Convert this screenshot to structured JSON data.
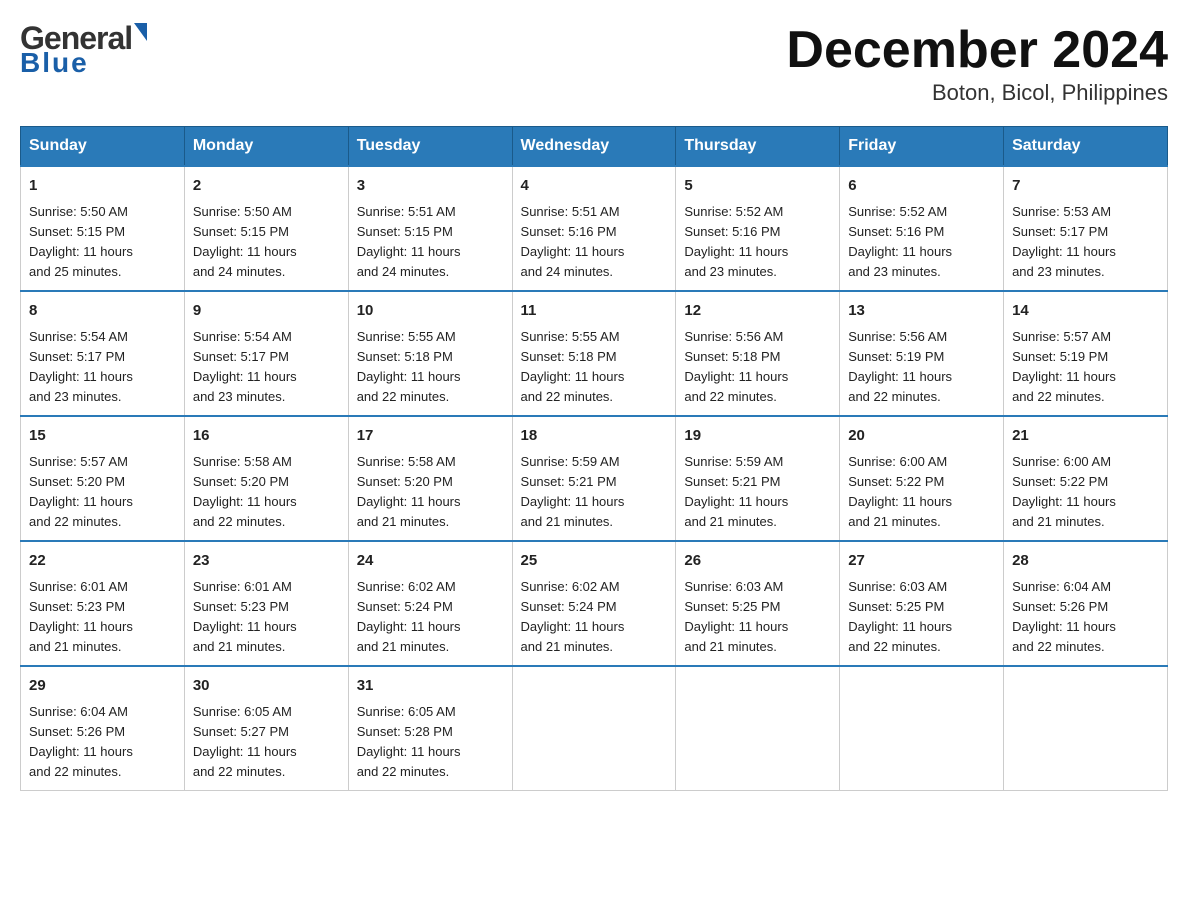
{
  "header": {
    "title": "December 2024",
    "subtitle": "Boton, Bicol, Philippines",
    "logo_general": "General",
    "logo_blue": "Blue"
  },
  "days_of_week": [
    "Sunday",
    "Monday",
    "Tuesday",
    "Wednesday",
    "Thursday",
    "Friday",
    "Saturday"
  ],
  "weeks": [
    [
      {
        "day": "1",
        "sunrise": "5:50 AM",
        "sunset": "5:15 PM",
        "daylight": "11 hours and 25 minutes."
      },
      {
        "day": "2",
        "sunrise": "5:50 AM",
        "sunset": "5:15 PM",
        "daylight": "11 hours and 24 minutes."
      },
      {
        "day": "3",
        "sunrise": "5:51 AM",
        "sunset": "5:15 PM",
        "daylight": "11 hours and 24 minutes."
      },
      {
        "day": "4",
        "sunrise": "5:51 AM",
        "sunset": "5:16 PM",
        "daylight": "11 hours and 24 minutes."
      },
      {
        "day": "5",
        "sunrise": "5:52 AM",
        "sunset": "5:16 PM",
        "daylight": "11 hours and 23 minutes."
      },
      {
        "day": "6",
        "sunrise": "5:52 AM",
        "sunset": "5:16 PM",
        "daylight": "11 hours and 23 minutes."
      },
      {
        "day": "7",
        "sunrise": "5:53 AM",
        "sunset": "5:17 PM",
        "daylight": "11 hours and 23 minutes."
      }
    ],
    [
      {
        "day": "8",
        "sunrise": "5:54 AM",
        "sunset": "5:17 PM",
        "daylight": "11 hours and 23 minutes."
      },
      {
        "day": "9",
        "sunrise": "5:54 AM",
        "sunset": "5:17 PM",
        "daylight": "11 hours and 23 minutes."
      },
      {
        "day": "10",
        "sunrise": "5:55 AM",
        "sunset": "5:18 PM",
        "daylight": "11 hours and 22 minutes."
      },
      {
        "day": "11",
        "sunrise": "5:55 AM",
        "sunset": "5:18 PM",
        "daylight": "11 hours and 22 minutes."
      },
      {
        "day": "12",
        "sunrise": "5:56 AM",
        "sunset": "5:18 PM",
        "daylight": "11 hours and 22 minutes."
      },
      {
        "day": "13",
        "sunrise": "5:56 AM",
        "sunset": "5:19 PM",
        "daylight": "11 hours and 22 minutes."
      },
      {
        "day": "14",
        "sunrise": "5:57 AM",
        "sunset": "5:19 PM",
        "daylight": "11 hours and 22 minutes."
      }
    ],
    [
      {
        "day": "15",
        "sunrise": "5:57 AM",
        "sunset": "5:20 PM",
        "daylight": "11 hours and 22 minutes."
      },
      {
        "day": "16",
        "sunrise": "5:58 AM",
        "sunset": "5:20 PM",
        "daylight": "11 hours and 22 minutes."
      },
      {
        "day": "17",
        "sunrise": "5:58 AM",
        "sunset": "5:20 PM",
        "daylight": "11 hours and 21 minutes."
      },
      {
        "day": "18",
        "sunrise": "5:59 AM",
        "sunset": "5:21 PM",
        "daylight": "11 hours and 21 minutes."
      },
      {
        "day": "19",
        "sunrise": "5:59 AM",
        "sunset": "5:21 PM",
        "daylight": "11 hours and 21 minutes."
      },
      {
        "day": "20",
        "sunrise": "6:00 AM",
        "sunset": "5:22 PM",
        "daylight": "11 hours and 21 minutes."
      },
      {
        "day": "21",
        "sunrise": "6:00 AM",
        "sunset": "5:22 PM",
        "daylight": "11 hours and 21 minutes."
      }
    ],
    [
      {
        "day": "22",
        "sunrise": "6:01 AM",
        "sunset": "5:23 PM",
        "daylight": "11 hours and 21 minutes."
      },
      {
        "day": "23",
        "sunrise": "6:01 AM",
        "sunset": "5:23 PM",
        "daylight": "11 hours and 21 minutes."
      },
      {
        "day": "24",
        "sunrise": "6:02 AM",
        "sunset": "5:24 PM",
        "daylight": "11 hours and 21 minutes."
      },
      {
        "day": "25",
        "sunrise": "6:02 AM",
        "sunset": "5:24 PM",
        "daylight": "11 hours and 21 minutes."
      },
      {
        "day": "26",
        "sunrise": "6:03 AM",
        "sunset": "5:25 PM",
        "daylight": "11 hours and 21 minutes."
      },
      {
        "day": "27",
        "sunrise": "6:03 AM",
        "sunset": "5:25 PM",
        "daylight": "11 hours and 22 minutes."
      },
      {
        "day": "28",
        "sunrise": "6:04 AM",
        "sunset": "5:26 PM",
        "daylight": "11 hours and 22 minutes."
      }
    ],
    [
      {
        "day": "29",
        "sunrise": "6:04 AM",
        "sunset": "5:26 PM",
        "daylight": "11 hours and 22 minutes."
      },
      {
        "day": "30",
        "sunrise": "6:05 AM",
        "sunset": "5:27 PM",
        "daylight": "11 hours and 22 minutes."
      },
      {
        "day": "31",
        "sunrise": "6:05 AM",
        "sunset": "5:28 PM",
        "daylight": "11 hours and 22 minutes."
      },
      {
        "day": "",
        "sunrise": "",
        "sunset": "",
        "daylight": ""
      },
      {
        "day": "",
        "sunrise": "",
        "sunset": "",
        "daylight": ""
      },
      {
        "day": "",
        "sunrise": "",
        "sunset": "",
        "daylight": ""
      },
      {
        "day": "",
        "sunrise": "",
        "sunset": "",
        "daylight": ""
      }
    ]
  ],
  "labels": {
    "sunrise": "Sunrise:",
    "sunset": "Sunset:",
    "daylight": "Daylight:"
  }
}
